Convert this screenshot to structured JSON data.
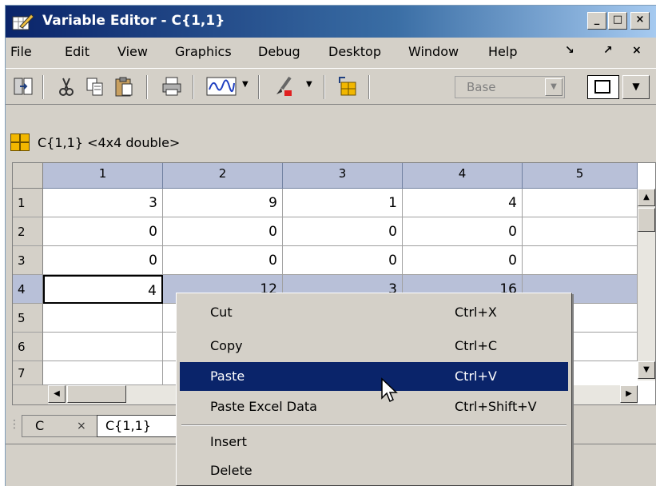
{
  "window": {
    "title": "Variable Editor - C{1,1}",
    "controls": [
      "_",
      "□",
      "×"
    ]
  },
  "menu": {
    "items": [
      "File",
      "Edit",
      "View",
      "Graphics",
      "Debug",
      "Desktop",
      "Window",
      "Help"
    ],
    "right": [
      "↘",
      "↗",
      "×"
    ]
  },
  "toolbar": {
    "base_select": "Base"
  },
  "variable": {
    "label": "C{1,1} <4x4 double>"
  },
  "sheet": {
    "columns": [
      "1",
      "2",
      "3",
      "4",
      "5"
    ],
    "rows": [
      {
        "header": "1",
        "values": [
          "3",
          "9",
          "1",
          "4",
          ""
        ]
      },
      {
        "header": "2",
        "values": [
          "0",
          "0",
          "0",
          "0",
          ""
        ]
      },
      {
        "header": "3",
        "values": [
          "0",
          "0",
          "0",
          "0",
          ""
        ]
      },
      {
        "header": "4",
        "values": [
          "4",
          "12",
          "3",
          "16",
          ""
        ]
      },
      {
        "header": "5",
        "values": [
          "",
          "",
          "",
          "",
          ""
        ]
      },
      {
        "header": "6",
        "values": [
          "",
          "",
          "",
          "",
          ""
        ]
      },
      {
        "header": "7",
        "values": [
          "",
          "",
          "",
          "",
          ""
        ]
      }
    ]
  },
  "tabs": {
    "items": [
      {
        "label": "C",
        "close": "×"
      },
      {
        "label": "C{1,1}"
      }
    ]
  },
  "context_menu": {
    "items": [
      {
        "label": "Cut",
        "shortcut": "Ctrl+X"
      },
      {
        "label": "Copy",
        "shortcut": "Ctrl+C"
      },
      {
        "label": "Paste",
        "shortcut": "Ctrl+V"
      },
      {
        "label": "Paste Excel Data",
        "shortcut": "Ctrl+Shift+V"
      },
      {
        "label": "Insert",
        "shortcut": ""
      },
      {
        "label": "Delete",
        "shortcut": ""
      }
    ],
    "highlighted": "Paste"
  }
}
